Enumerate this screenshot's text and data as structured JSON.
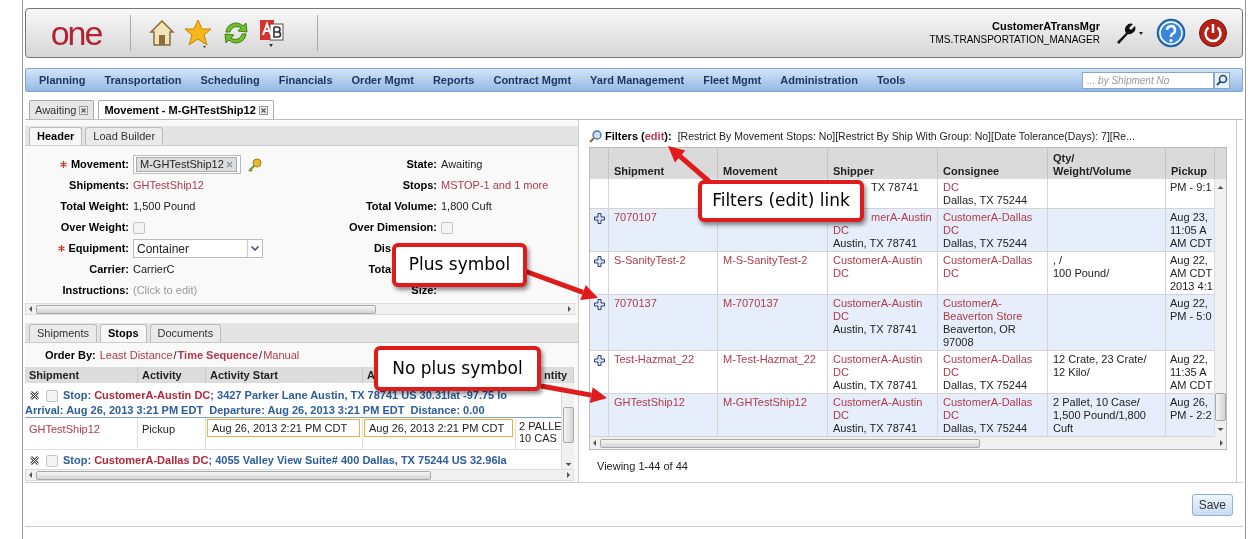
{
  "app_header": {
    "logo": "one",
    "user": "CustomerATransMgr",
    "role": "TMS.TRANSPORTATION_MANAGER"
  },
  "nav": {
    "items": [
      "Planning",
      "Transportation",
      "Scheduling",
      "Financials",
      "Order Mgmt",
      "Reports",
      "Contract Mgmt",
      "Yard Management",
      "Fleet Mgmt",
      "Administration",
      "Tools"
    ],
    "search": {
      "placeholder": "... by Shipment No"
    }
  },
  "doc_tabs": [
    {
      "label": "Awaiting",
      "selected": false
    },
    {
      "label": "Movement - M-GHTestShip12",
      "selected": true
    }
  ],
  "left_panel": {
    "tabs": [
      {
        "label": "Header",
        "selected": true
      },
      {
        "label": "Load Builder",
        "selected": false
      }
    ],
    "form": [
      {
        "left": {
          "label": "Movement:",
          "required": true,
          "kind": "chip",
          "value": "M-GHTestShip12"
        },
        "right": {
          "label": "State:",
          "kind": "text",
          "value": "Awaiting"
        }
      },
      {
        "left": {
          "label": "Shipments:",
          "kind": "link",
          "value": "GHTestShip12"
        },
        "right": {
          "label": "Stops:",
          "kind": "link",
          "value": "MSTOP-1 and 1 more"
        }
      },
      {
        "left": {
          "label": "Total Weight:",
          "kind": "text",
          "value": "1,500 Pound"
        },
        "right": {
          "label": "Total Volume:",
          "kind": "text",
          "value": "1,800 Cuft"
        }
      },
      {
        "left": {
          "label": "Over Weight:",
          "kind": "checkbox",
          "checked": false
        },
        "right": {
          "label": "Over Dimension:",
          "kind": "checkbox",
          "checked": false
        }
      },
      {
        "left": {
          "label": "Equipment:",
          "required": true,
          "kind": "select",
          "value": "Container"
        },
        "right": {
          "label": "Dis",
          "cut": true
        }
      },
      {
        "left": {
          "label": "Carrier:",
          "kind": "text",
          "value": "CarrierC"
        },
        "right": {
          "label": "Tota",
          "cut": true
        }
      },
      {
        "left": {
          "label": "Instructions:",
          "kind": "hint",
          "placeholder": "(Click to edit)"
        },
        "right": {
          "label": "Size:"
        }
      }
    ],
    "sub_tabs": [
      {
        "label": "Shipments",
        "selected": false
      },
      {
        "label": "Stops",
        "selected": true
      },
      {
        "label": "Documents",
        "selected": false
      }
    ],
    "order_by": {
      "label": "Order By:",
      "options": [
        {
          "label": "Least Distance",
          "selected": false
        },
        {
          "label": "Time Sequence",
          "selected": true,
          "separator": "/"
        },
        {
          "label": "Manual",
          "selected": false,
          "separator": "/"
        }
      ]
    },
    "stops_table": {
      "columns": [
        {
          "label": "Shipment"
        },
        {
          "label": "Activity"
        },
        {
          "label": "Activity Start"
        },
        {
          "label": "A"
        },
        {
          "label": "ntity",
          "cut": true
        }
      ],
      "stops": [
        {
          "checked": false,
          "prefix": "Stop:",
          "name": "CustomerA-Austin DC",
          "address": "; 3427 Parker Lane Austin, TX 78741 US 30.31lat -97.75 lo",
          "details": "Arrival: Aug 26, 2013 3:21 PM EDT  Departure: Aug 26, 2013 3:21 PM EDT  Distance: 0.00",
          "rows": [
            {
              "shipment": "GHTestShip12",
              "activity": "Pickup",
              "start": "Aug 26, 2013 2:21 PM CDT",
              "end": "Aug 26, 2013 2:21 PM CDT",
              "quantity": [
                "2 PALLE",
                "10 CAS"
              ]
            }
          ]
        },
        {
          "checked": false,
          "prefix": "Stop:",
          "name": "CustomerA-Dallas DC",
          "address": "; 4055 Valley View Suite# 400 Dallas, TX 75244 US 32.96la"
        }
      ]
    }
  },
  "right_panel": {
    "filters": {
      "label_before": "Filters (",
      "link": "edit",
      "label_after": "):",
      "summary": "[Restrict By Movement Stops: No][Restrict By Ship With Group: No][Date Tolerance(Days): 7][Re..."
    },
    "table": {
      "columns": [
        "Shipment",
        "Movement",
        "Shipper",
        "Consignee",
        "Qty/\nWeight/Volume",
        "Pickup"
      ],
      "rows": [
        {
          "expandable": false,
          "shipper": {
            "plain": [
              "TX 78741"
            ],
            "cut": true
          },
          "consignee": {
            "links": [
              "DC"
            ],
            "plain": [
              "Dallas, TX 75244"
            ]
          },
          "pickup": [
            "PM - 9:1"
          ]
        },
        {
          "expandable": true,
          "shipment": "7070107",
          "shipper": {
            "links": [
              "merA-Austin",
              "DC"
            ],
            "plain": [
              "Austin, TX 78741"
            ],
            "cut": true
          },
          "consignee": {
            "links": [
              "CustomerA-Dallas",
              "DC"
            ],
            "plain": [
              "Dallas, TX 75244"
            ]
          },
          "pickup": [
            "Aug 23,",
            "11:05 A",
            "AM CDT"
          ]
        },
        {
          "expandable": true,
          "shipment": "S-SanityTest-2",
          "movement": "M-S-SanityTest-2",
          "shipper": {
            "links": [
              "CustomerA-Austin",
              "DC"
            ]
          },
          "consignee": {
            "links": [
              "CustomerA-Dallas",
              "DC"
            ]
          },
          "qty": [
            ", /",
            "100 Pound/"
          ],
          "pickup": [
            "Aug 22,",
            "AM CDT",
            "2013 4:1"
          ]
        },
        {
          "expandable": true,
          "shipment": "7070137",
          "movement": "M-7070137",
          "shipper": {
            "links": [
              "CustomerA-Austin",
              "DC"
            ],
            "plain": [
              "Austin, TX 78741"
            ]
          },
          "consignee": {
            "links": [
              "CustomerA-",
              "Beaverton Store"
            ],
            "plain": [
              "Beaverton, OR",
              "97008"
            ]
          },
          "pickup": [
            "Aug 22,",
            "PM - 5:0"
          ]
        },
        {
          "expandable": true,
          "shipment": "Test-Hazmat_22",
          "movement": "M-Test-Hazmat_22",
          "shipper": {
            "links": [
              "CustomerA-Austin",
              "DC"
            ],
            "plain": [
              "Austin, TX 78741"
            ]
          },
          "consignee": {
            "links": [
              "CustomerA-Dallas",
              "DC"
            ],
            "plain": [
              "Dallas, TX 75244"
            ]
          },
          "qty": [
            "12 Crate, 23 Crate/",
            "12 Kilo/"
          ],
          "pickup": [
            "Aug 22,",
            "11:35 A",
            "AM CDT"
          ]
        },
        {
          "expandable": false,
          "shipment": "GHTestShip12",
          "movement": "M-GHTestShip12",
          "shipper": {
            "links": [
              "CustomerA-Austin",
              "DC"
            ],
            "plain": [
              "Austin, TX 78741"
            ]
          },
          "consignee": {
            "links": [
              "CustomerA-Dallas",
              "DC"
            ],
            "plain": [
              "Dallas, TX 75244"
            ]
          },
          "qty": [
            "2 Pallet, 10 Case/",
            "1,500 Pound/1,800",
            "Cuft"
          ],
          "pickup": [
            "Aug 26,",
            "PM - 2:2"
          ]
        }
      ]
    },
    "pager": "Viewing 1-44 of 44"
  },
  "save_button": "Save",
  "callouts": [
    {
      "text": "Filters (edit) link"
    },
    {
      "text": "Plus symbol"
    },
    {
      "text": "No plus symbol"
    }
  ]
}
